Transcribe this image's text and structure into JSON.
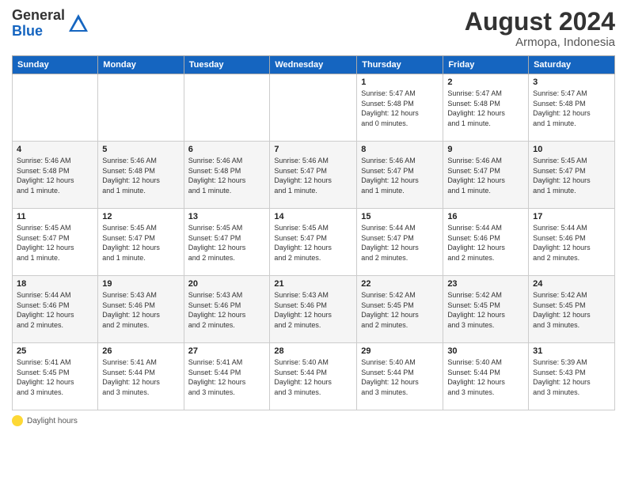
{
  "header": {
    "logo_general": "General",
    "logo_blue": "Blue",
    "month_title": "August 2024",
    "location": "Armopa, Indonesia"
  },
  "days_of_week": [
    "Sunday",
    "Monday",
    "Tuesday",
    "Wednesday",
    "Thursday",
    "Friday",
    "Saturday"
  ],
  "weeks": [
    [
      {
        "day": "",
        "info": ""
      },
      {
        "day": "",
        "info": ""
      },
      {
        "day": "",
        "info": ""
      },
      {
        "day": "",
        "info": ""
      },
      {
        "day": "1",
        "info": "Sunrise: 5:47 AM\nSunset: 5:48 PM\nDaylight: 12 hours\nand 0 minutes."
      },
      {
        "day": "2",
        "info": "Sunrise: 5:47 AM\nSunset: 5:48 PM\nDaylight: 12 hours\nand 1 minute."
      },
      {
        "day": "3",
        "info": "Sunrise: 5:47 AM\nSunset: 5:48 PM\nDaylight: 12 hours\nand 1 minute."
      }
    ],
    [
      {
        "day": "4",
        "info": "Sunrise: 5:46 AM\nSunset: 5:48 PM\nDaylight: 12 hours\nand 1 minute."
      },
      {
        "day": "5",
        "info": "Sunrise: 5:46 AM\nSunset: 5:48 PM\nDaylight: 12 hours\nand 1 minute."
      },
      {
        "day": "6",
        "info": "Sunrise: 5:46 AM\nSunset: 5:48 PM\nDaylight: 12 hours\nand 1 minute."
      },
      {
        "day": "7",
        "info": "Sunrise: 5:46 AM\nSunset: 5:47 PM\nDaylight: 12 hours\nand 1 minute."
      },
      {
        "day": "8",
        "info": "Sunrise: 5:46 AM\nSunset: 5:47 PM\nDaylight: 12 hours\nand 1 minute."
      },
      {
        "day": "9",
        "info": "Sunrise: 5:46 AM\nSunset: 5:47 PM\nDaylight: 12 hours\nand 1 minute."
      },
      {
        "day": "10",
        "info": "Sunrise: 5:45 AM\nSunset: 5:47 PM\nDaylight: 12 hours\nand 1 minute."
      }
    ],
    [
      {
        "day": "11",
        "info": "Sunrise: 5:45 AM\nSunset: 5:47 PM\nDaylight: 12 hours\nand 1 minute."
      },
      {
        "day": "12",
        "info": "Sunrise: 5:45 AM\nSunset: 5:47 PM\nDaylight: 12 hours\nand 1 minute."
      },
      {
        "day": "13",
        "info": "Sunrise: 5:45 AM\nSunset: 5:47 PM\nDaylight: 12 hours\nand 2 minutes."
      },
      {
        "day": "14",
        "info": "Sunrise: 5:45 AM\nSunset: 5:47 PM\nDaylight: 12 hours\nand 2 minutes."
      },
      {
        "day": "15",
        "info": "Sunrise: 5:44 AM\nSunset: 5:47 PM\nDaylight: 12 hours\nand 2 minutes."
      },
      {
        "day": "16",
        "info": "Sunrise: 5:44 AM\nSunset: 5:46 PM\nDaylight: 12 hours\nand 2 minutes."
      },
      {
        "day": "17",
        "info": "Sunrise: 5:44 AM\nSunset: 5:46 PM\nDaylight: 12 hours\nand 2 minutes."
      }
    ],
    [
      {
        "day": "18",
        "info": "Sunrise: 5:44 AM\nSunset: 5:46 PM\nDaylight: 12 hours\nand 2 minutes."
      },
      {
        "day": "19",
        "info": "Sunrise: 5:43 AM\nSunset: 5:46 PM\nDaylight: 12 hours\nand 2 minutes."
      },
      {
        "day": "20",
        "info": "Sunrise: 5:43 AM\nSunset: 5:46 PM\nDaylight: 12 hours\nand 2 minutes."
      },
      {
        "day": "21",
        "info": "Sunrise: 5:43 AM\nSunset: 5:46 PM\nDaylight: 12 hours\nand 2 minutes."
      },
      {
        "day": "22",
        "info": "Sunrise: 5:42 AM\nSunset: 5:45 PM\nDaylight: 12 hours\nand 2 minutes."
      },
      {
        "day": "23",
        "info": "Sunrise: 5:42 AM\nSunset: 5:45 PM\nDaylight: 12 hours\nand 3 minutes."
      },
      {
        "day": "24",
        "info": "Sunrise: 5:42 AM\nSunset: 5:45 PM\nDaylight: 12 hours\nand 3 minutes."
      }
    ],
    [
      {
        "day": "25",
        "info": "Sunrise: 5:41 AM\nSunset: 5:45 PM\nDaylight: 12 hours\nand 3 minutes."
      },
      {
        "day": "26",
        "info": "Sunrise: 5:41 AM\nSunset: 5:44 PM\nDaylight: 12 hours\nand 3 minutes."
      },
      {
        "day": "27",
        "info": "Sunrise: 5:41 AM\nSunset: 5:44 PM\nDaylight: 12 hours\nand 3 minutes."
      },
      {
        "day": "28",
        "info": "Sunrise: 5:40 AM\nSunset: 5:44 PM\nDaylight: 12 hours\nand 3 minutes."
      },
      {
        "day": "29",
        "info": "Sunrise: 5:40 AM\nSunset: 5:44 PM\nDaylight: 12 hours\nand 3 minutes."
      },
      {
        "day": "30",
        "info": "Sunrise: 5:40 AM\nSunset: 5:44 PM\nDaylight: 12 hours\nand 3 minutes."
      },
      {
        "day": "31",
        "info": "Sunrise: 5:39 AM\nSunset: 5:43 PM\nDaylight: 12 hours\nand 3 minutes."
      }
    ]
  ],
  "footer": {
    "daylight_label": "Daylight hours"
  }
}
